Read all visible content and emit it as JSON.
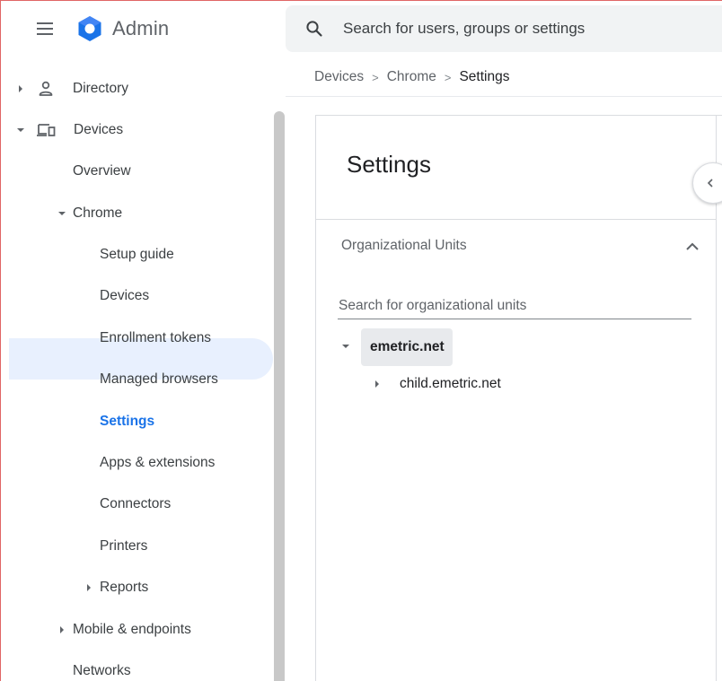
{
  "app": {
    "title": "Admin",
    "menu_icon": "hamburger-menu-icon",
    "logo_icon": "admin-logo-icon"
  },
  "search": {
    "placeholder": "Search for users, groups or settings",
    "icon": "search-icon"
  },
  "sidebar": {
    "items": [
      {
        "label": "Directory",
        "icon": "person-icon",
        "expander": "collapsed"
      },
      {
        "label": "Devices",
        "icon": "devices-icon",
        "expander": "expanded"
      },
      {
        "label": "Overview"
      },
      {
        "label": "Chrome",
        "expander": "expanded"
      },
      {
        "label": "Setup guide"
      },
      {
        "label": "Devices"
      },
      {
        "label": "Enrollment tokens"
      },
      {
        "label": "Managed browsers"
      },
      {
        "label": "Settings",
        "selected": true
      },
      {
        "label": "Apps & extensions"
      },
      {
        "label": "Connectors"
      },
      {
        "label": "Printers"
      },
      {
        "label": "Reports",
        "expander": "collapsed"
      },
      {
        "label": "Mobile & endpoints",
        "expander": "collapsed"
      },
      {
        "label": "Networks"
      }
    ]
  },
  "breadcrumb": {
    "items": [
      "Devices",
      "Chrome",
      "Settings"
    ],
    "separator": ">"
  },
  "main": {
    "title": "Settings",
    "collapse_icon": "chevron-left-icon",
    "org_units": {
      "header": "Organizational Units",
      "header_icon": "chevron-up-icon",
      "search_placeholder": "Search for organizational units",
      "root": "emetric.net",
      "children": [
        "child.emetric.net"
      ]
    }
  },
  "colors": {
    "accent": "#1a73e8",
    "selected_bg": "#e8f0fe",
    "logo_blue": "#1a73e8",
    "logo_light": "#4285f4"
  }
}
